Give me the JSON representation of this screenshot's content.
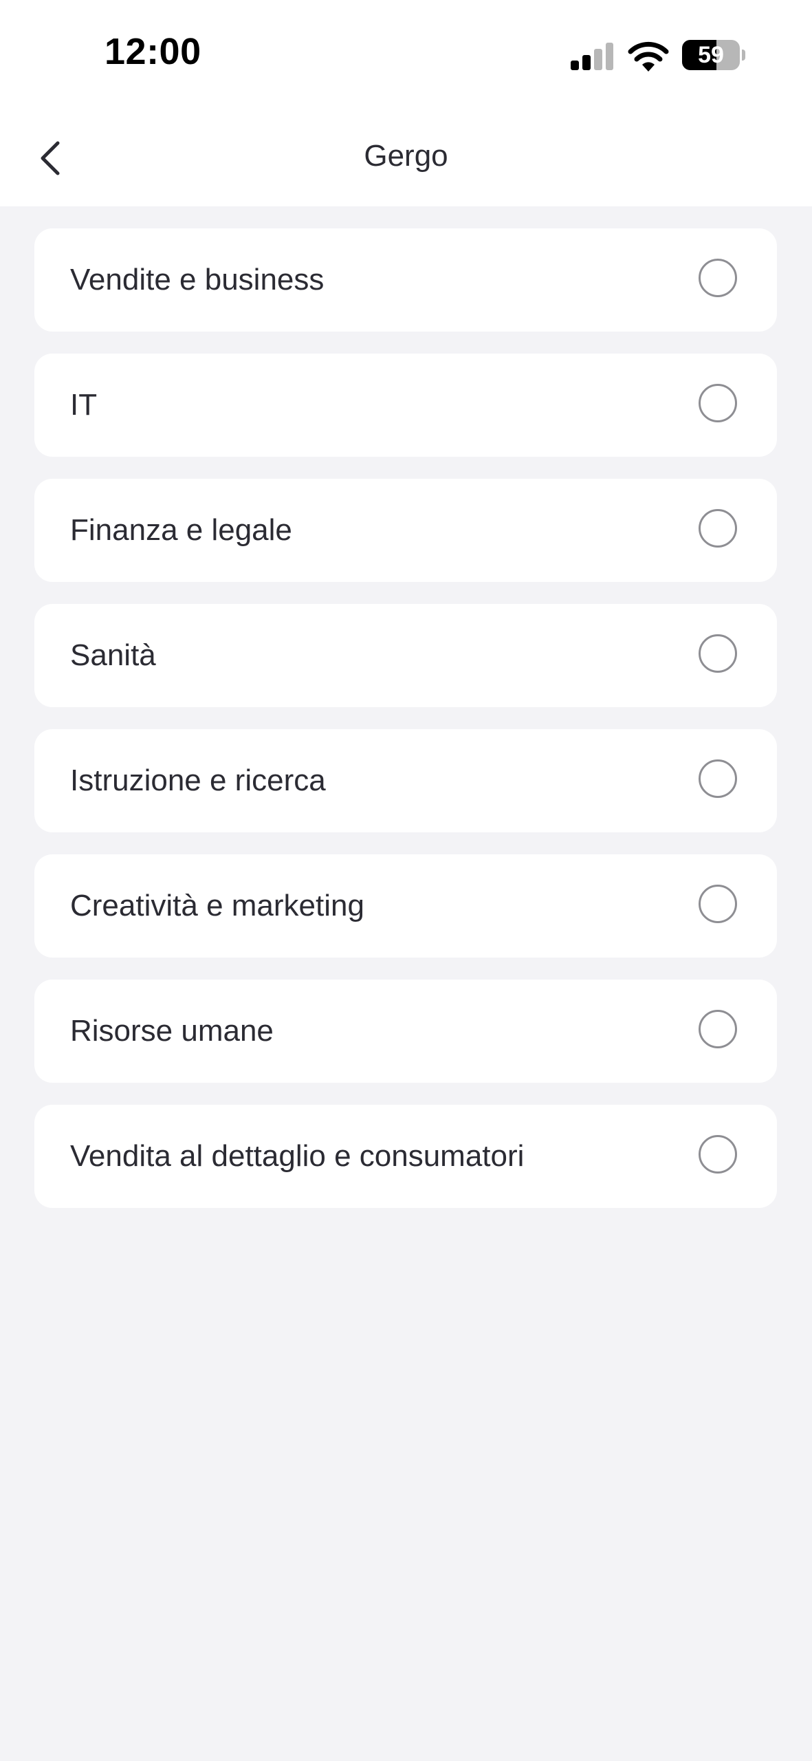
{
  "status_bar": {
    "time": "12:00",
    "battery_level": "59",
    "icons": [
      "signal-icon",
      "wifi-icon",
      "battery-icon"
    ]
  },
  "nav": {
    "title": "Gergo",
    "back_icon": "chevron-left-icon"
  },
  "options": [
    {
      "label": "Vendite e business",
      "selected": false
    },
    {
      "label": "IT",
      "selected": false
    },
    {
      "label": "Finanza e legale",
      "selected": false
    },
    {
      "label": "Sanità",
      "selected": false
    },
    {
      "label": "Istruzione e ricerca",
      "selected": false
    },
    {
      "label": "Creatività e marketing",
      "selected": false
    },
    {
      "label": "Risorse umane",
      "selected": false
    },
    {
      "label": "Vendita al dettaglio e consumatori",
      "selected": false
    }
  ],
  "colors": {
    "background": "#f3f3f6",
    "card": "#ffffff",
    "text": "#2b2b33",
    "radio_border": "#8e8e93"
  }
}
